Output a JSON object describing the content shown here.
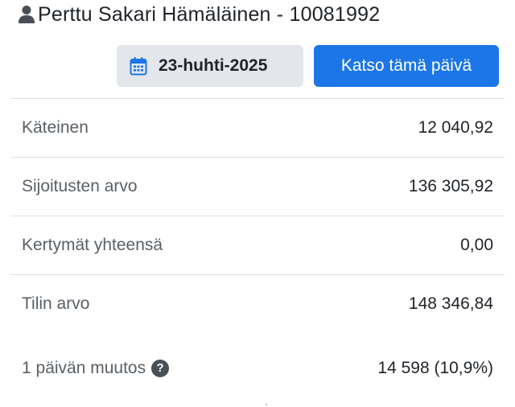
{
  "header": {
    "icon": "person-icon",
    "title": "Perttu Sakari Hämäläinen - 10081992"
  },
  "toolbar": {
    "date_icon": "calendar-icon",
    "date_label": "23-huhti-2025",
    "view_day_label": "Katso tämä päivä",
    "accent_color": "#1c76e8"
  },
  "summary": {
    "rows": [
      {
        "label": "Käteinen",
        "value": "12 040,92"
      },
      {
        "label": "Sijoitusten arvo",
        "value": "136 305,92"
      },
      {
        "label": "Kertymät yhteensä",
        "value": "0,00"
      },
      {
        "label": "Tilin arvo",
        "value": "148 346,84"
      }
    ],
    "change": {
      "label": "1 päivän muutos",
      "help_icon": "question-icon",
      "help_glyph": "?",
      "value": "14 598 (10,9%)"
    }
  }
}
